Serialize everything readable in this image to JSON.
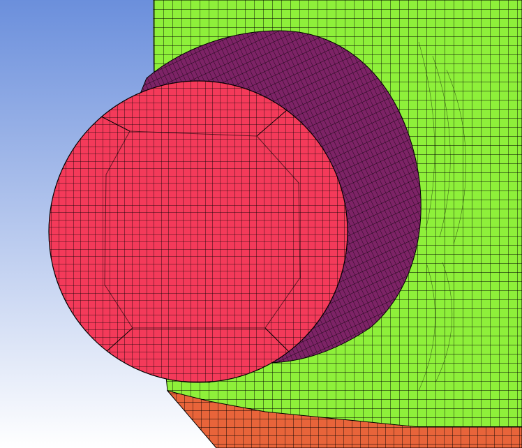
{
  "viewport": {
    "background_top": "#6b8fdc",
    "background_bottom": "#ffffff"
  },
  "colors": {
    "body_surface": "#8ef03a",
    "pipe_side": "#7d2366",
    "pipe_face": "#f43a5a",
    "lower_section": "#e8643a",
    "mesh_line": "#000000"
  },
  "parts": [
    {
      "id": "vessel-body",
      "label": "",
      "color": "#8ef03a"
    },
    {
      "id": "nozzle-side",
      "label": "",
      "color": "#7d2366"
    },
    {
      "id": "nozzle-face",
      "label": "",
      "color": "#f43a5a"
    },
    {
      "id": "lower-cone",
      "label": "",
      "color": "#e8643a"
    }
  ]
}
